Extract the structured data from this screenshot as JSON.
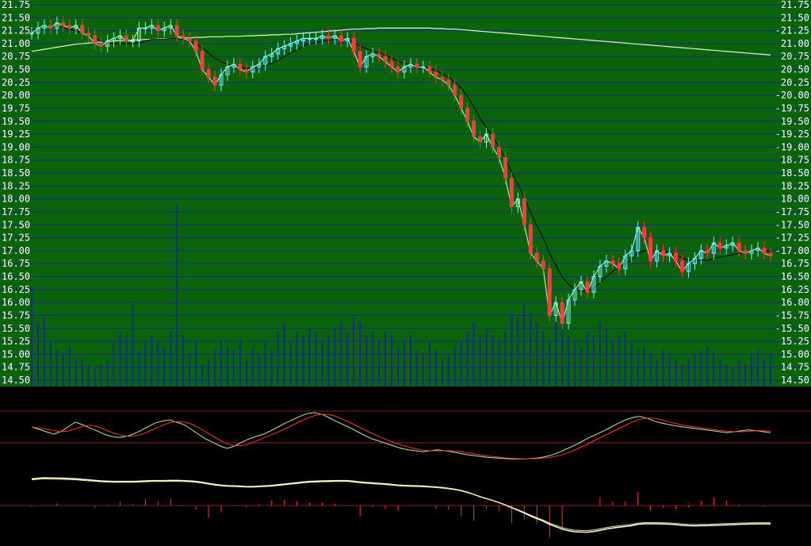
{
  "chart_data": {
    "type": "candlestick",
    "y_ticks": [
      "21.75",
      "21.50",
      "21.25",
      "21.00",
      "20.75",
      "20.50",
      "20.25",
      "20.00",
      "19.75",
      "19.50",
      "19.25",
      "19.00",
      "18.75",
      "18.50",
      "18.25",
      "18.00",
      "17.75",
      "17.50",
      "17.25",
      "17.00",
      "16.75",
      "16.50",
      "16.25",
      "16.00",
      "15.75",
      "15.50",
      "15.25",
      "15.00",
      "14.75",
      "14.50"
    ],
    "y_ticks_right": [
      "21.75",
      "21.50",
      "-21.25",
      "21.00",
      "20.75",
      "20.50",
      "20.25",
      "-20.00",
      "-19.75",
      "19.50",
      "-19.25",
      "-19.00",
      "18.75",
      "18.50",
      "18.25",
      "18.00",
      "-17.75",
      "-17.50",
      "-17.25",
      "-17.00",
      "16.75",
      "16.50",
      "16.25",
      "16.00",
      "-15.75",
      "-15.50",
      "15.25",
      "15.00",
      "14.75",
      "14.50"
    ],
    "ylim": [
      14.5,
      21.75
    ],
    "close": [
      21.2,
      21.3,
      21.35,
      21.3,
      21.4,
      21.35,
      21.3,
      21.35,
      21.2,
      21.15,
      21.0,
      20.95,
      21.05,
      21.1,
      21.15,
      21.05,
      21.05,
      21.3,
      21.3,
      21.35,
      21.25,
      21.3,
      21.35,
      21.15,
      21.1,
      21.05,
      20.85,
      20.5,
      20.35,
      20.2,
      20.4,
      20.55,
      20.6,
      20.5,
      20.45,
      20.55,
      20.6,
      20.75,
      20.8,
      20.9,
      20.95,
      21.0,
      21.05,
      21.1,
      21.1,
      21.1,
      21.15,
      21.1,
      21.15,
      21.05,
      21.1,
      20.85,
      20.55,
      20.75,
      20.8,
      20.75,
      20.65,
      20.55,
      20.45,
      20.55,
      20.6,
      20.55,
      20.55,
      20.45,
      20.35,
      20.3,
      20.2,
      20.0,
      19.75,
      19.5,
      19.2,
      19.1,
      19.25,
      19.0,
      18.8,
      18.4,
      17.85,
      18.0,
      17.5,
      16.95,
      16.8,
      16.65,
      15.75,
      16.0,
      15.6,
      16.05,
      16.25,
      16.4,
      16.2,
      16.5,
      16.7,
      16.8,
      16.75,
      16.65,
      16.9,
      17.0,
      17.45,
      17.25,
      16.8,
      17.0,
      16.9,
      16.95,
      16.8,
      16.6,
      16.75,
      16.85,
      17.0,
      16.95,
      17.15,
      17.05,
      17.1,
      17.15,
      17.0,
      16.95,
      17.0,
      17.05,
      16.95,
      16.9
    ],
    "ma_short": [
      21.25,
      21.3,
      21.35,
      21.32,
      21.32,
      21.3,
      21.28,
      21.25,
      21.2,
      21.15,
      21.1,
      21.05,
      21.02,
      21.0,
      21.0,
      21.0,
      21.0,
      21.02,
      21.05,
      21.08,
      21.08,
      21.08,
      21.1,
      21.1,
      21.08,
      21.05,
      21.0,
      20.92,
      20.82,
      20.72,
      20.65,
      20.6,
      20.58,
      20.55,
      20.52,
      20.52,
      20.55,
      20.58,
      20.62,
      20.68,
      20.75,
      20.82,
      20.88,
      20.95,
      21.0,
      21.02,
      21.05,
      21.06,
      21.08,
      21.08,
      21.08,
      21.02,
      20.95,
      20.9,
      20.86,
      20.82,
      20.78,
      20.72,
      20.66,
      20.62,
      20.6,
      20.58,
      20.56,
      20.52,
      20.48,
      20.42,
      20.35,
      20.26,
      20.14,
      19.98,
      19.78,
      19.56,
      19.38,
      19.2,
      19.0,
      18.78,
      18.52,
      18.28,
      18.02,
      17.74,
      17.48,
      17.25,
      16.95,
      16.72,
      16.5,
      16.35,
      16.25,
      16.22,
      16.2,
      16.28,
      16.38,
      16.5,
      16.6,
      16.68,
      16.75,
      16.82,
      16.95,
      17.0,
      17.0,
      17.0,
      16.98,
      16.96,
      16.92,
      16.86,
      16.82,
      16.8,
      16.82,
      16.82,
      16.85,
      16.88,
      16.9,
      16.92,
      16.95,
      16.96,
      16.98,
      16.99,
      16.99,
      16.98
    ],
    "ma_long": [
      20.85,
      20.87,
      20.89,
      20.91,
      20.93,
      20.95,
      20.97,
      20.99,
      21.0,
      21.01,
      21.02,
      21.03,
      21.04,
      21.05,
      21.06,
      21.06,
      21.07,
      21.07,
      21.08,
      21.08,
      21.09,
      21.09,
      21.1,
      21.1,
      21.11,
      21.11,
      21.12,
      21.12,
      21.13,
      21.13,
      21.13,
      21.14,
      21.14,
      21.14,
      21.15,
      21.15,
      21.16,
      21.16,
      21.17,
      21.17,
      21.18,
      21.18,
      21.19,
      21.2,
      21.21,
      21.22,
      21.23,
      21.24,
      21.25,
      21.26,
      21.27,
      21.28,
      21.28,
      21.29,
      21.29,
      21.3,
      21.3,
      21.3,
      21.3,
      21.3,
      21.3,
      21.3,
      21.3,
      21.3,
      21.29,
      21.29,
      21.28,
      21.28,
      21.27,
      21.26,
      21.25,
      21.24,
      21.23,
      21.22,
      21.21,
      21.2,
      21.19,
      21.18,
      21.17,
      21.16,
      21.15,
      21.14,
      21.13,
      21.12,
      21.11,
      21.1,
      21.09,
      21.08,
      21.07,
      21.06,
      21.05,
      21.04,
      21.03,
      21.02,
      21.01,
      21.0,
      20.99,
      20.98,
      20.97,
      20.96,
      20.95,
      20.94,
      20.93,
      20.92,
      20.91,
      20.9,
      20.89,
      20.88,
      20.87,
      20.86,
      20.85,
      20.84,
      20.83,
      20.82,
      20.81,
      20.8,
      20.79,
      20.78
    ],
    "volume": [
      55,
      35,
      38,
      25,
      20,
      18,
      22,
      15,
      15,
      12,
      10,
      12,
      14,
      25,
      30,
      28,
      45,
      20,
      25,
      28,
      25,
      22,
      30,
      100,
      28,
      18,
      25,
      12,
      15,
      20,
      25,
      22,
      20,
      25,
      15,
      22,
      18,
      25,
      20,
      30,
      35,
      25,
      30,
      28,
      32,
      30,
      25,
      28,
      32,
      35,
      30,
      38,
      35,
      28,
      30,
      25,
      30,
      28,
      22,
      25,
      28,
      20,
      18,
      25,
      20,
      15,
      18,
      22,
      25,
      30,
      35,
      28,
      32,
      28,
      25,
      30,
      40,
      38,
      45,
      40,
      35,
      30,
      25,
      38,
      32,
      28,
      25,
      22,
      30,
      28,
      35,
      32,
      25,
      28,
      30,
      25,
      20,
      22,
      18,
      15,
      20,
      18,
      15,
      12,
      15,
      18,
      20,
      22,
      18,
      15,
      12,
      10,
      15,
      12,
      18,
      20,
      15,
      18
    ],
    "osc_k": [
      0.7,
      0.65,
      0.6,
      0.55,
      0.6,
      0.7,
      0.8,
      0.75,
      0.68,
      0.62,
      0.55,
      0.5,
      0.48,
      0.5,
      0.55,
      0.62,
      0.7,
      0.78,
      0.82,
      0.85,
      0.8,
      0.75,
      0.65,
      0.55,
      0.45,
      0.38,
      0.3,
      0.25,
      0.3,
      0.38,
      0.45,
      0.5,
      0.55,
      0.62,
      0.7,
      0.78,
      0.85,
      0.92,
      0.98,
      1.0,
      0.97,
      0.9,
      0.82,
      0.75,
      0.68,
      0.6,
      0.52,
      0.45,
      0.4,
      0.35,
      0.3,
      0.25,
      0.22,
      0.2,
      0.18,
      0.2,
      0.22,
      0.2,
      0.18,
      0.15,
      0.12,
      0.1,
      0.08,
      0.06,
      0.05,
      0.04,
      0.03,
      0.03,
      0.03,
      0.04,
      0.05,
      0.08,
      0.12,
      0.18,
      0.25,
      0.32,
      0.4,
      0.48,
      0.55,
      0.62,
      0.7,
      0.78,
      0.85,
      0.9,
      0.92,
      0.88,
      0.82,
      0.78,
      0.75,
      0.72,
      0.7,
      0.68,
      0.66,
      0.64,
      0.62,
      0.6,
      0.58,
      0.6,
      0.62,
      0.64,
      0.62,
      0.6,
      0.58
    ]
  }
}
